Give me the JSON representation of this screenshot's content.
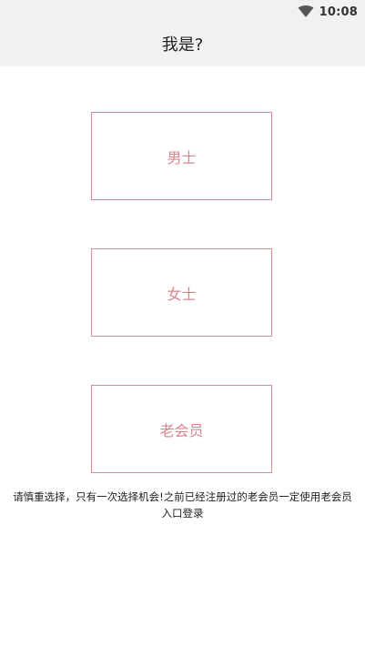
{
  "status_bar": {
    "time": "10:08",
    "wifi_icon": "wifi-icon"
  },
  "header": {
    "title": "我是?"
  },
  "options": [
    {
      "label": "男士"
    },
    {
      "label": "女士"
    },
    {
      "label": "老会员"
    }
  ],
  "notice": {
    "text": "请慎重选择，只有一次选择机会!之前已经注册过的老会员一定使用老会员 入口登录"
  },
  "colors": {
    "header_bg": "#f1f1f1",
    "accent": "#d9848e",
    "border": "#d98a93"
  }
}
